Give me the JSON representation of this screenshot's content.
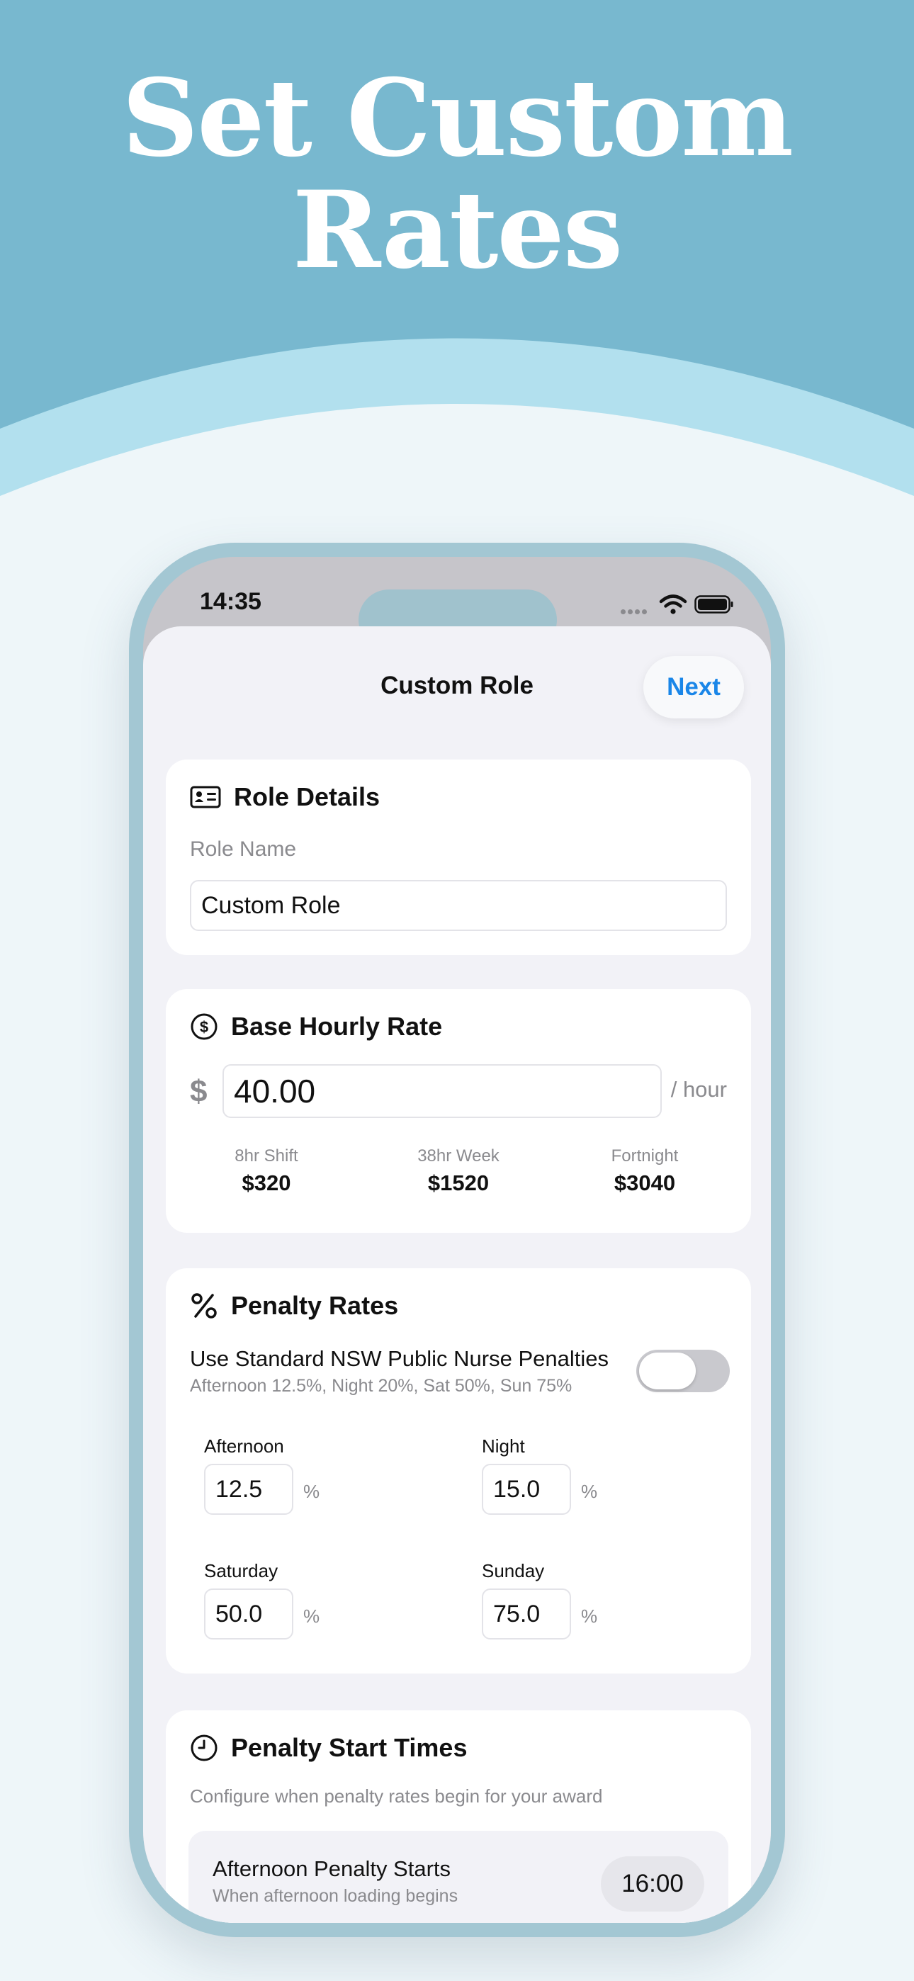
{
  "hero": {
    "title_line1": "Set Custom",
    "title_line2": "Rates"
  },
  "status_bar": {
    "time": "14:35"
  },
  "nav": {
    "title": "Custom Role",
    "next_label": "Next"
  },
  "role_details": {
    "title": "Role Details",
    "role_name_label": "Role Name",
    "role_name_value": "Custom Role"
  },
  "base_rate": {
    "title": "Base Hourly Rate",
    "currency_symbol": "$",
    "rate_value": "40.00",
    "unit": "/ hour",
    "summaries": [
      {
        "label": "8hr Shift",
        "value": "$320"
      },
      {
        "label": "38hr Week",
        "value": "$1520"
      },
      {
        "label": "Fortnight",
        "value": "$3040"
      }
    ]
  },
  "penalty_rates": {
    "title": "Penalty Rates",
    "standard_toggle_label": "Use Standard NSW Public Nurse Penalties",
    "standard_toggle_sub": "Afternoon 12.5%, Night 20%, Sat 50%, Sun 75%",
    "standard_toggle_on": false,
    "unit": "%",
    "items": [
      {
        "label": "Afternoon",
        "value": "12.5"
      },
      {
        "label": "Night",
        "value": "15.0"
      },
      {
        "label": "Saturday",
        "value": "50.0"
      },
      {
        "label": "Sunday",
        "value": "75.0"
      }
    ]
  },
  "penalty_start_times": {
    "title": "Penalty Start Times",
    "description": "Configure when penalty rates begin for your award",
    "rows": [
      {
        "title": "Afternoon Penalty Starts",
        "subtitle": "When afternoon loading begins",
        "time": "16:00"
      }
    ]
  },
  "colors": {
    "hero_dark": "#78b8cf",
    "hero_light": "#b2e0ee",
    "page_bg": "#eef6f9",
    "accent_blue": "#1a86e8",
    "phone_frame": "#a3c7d3"
  }
}
